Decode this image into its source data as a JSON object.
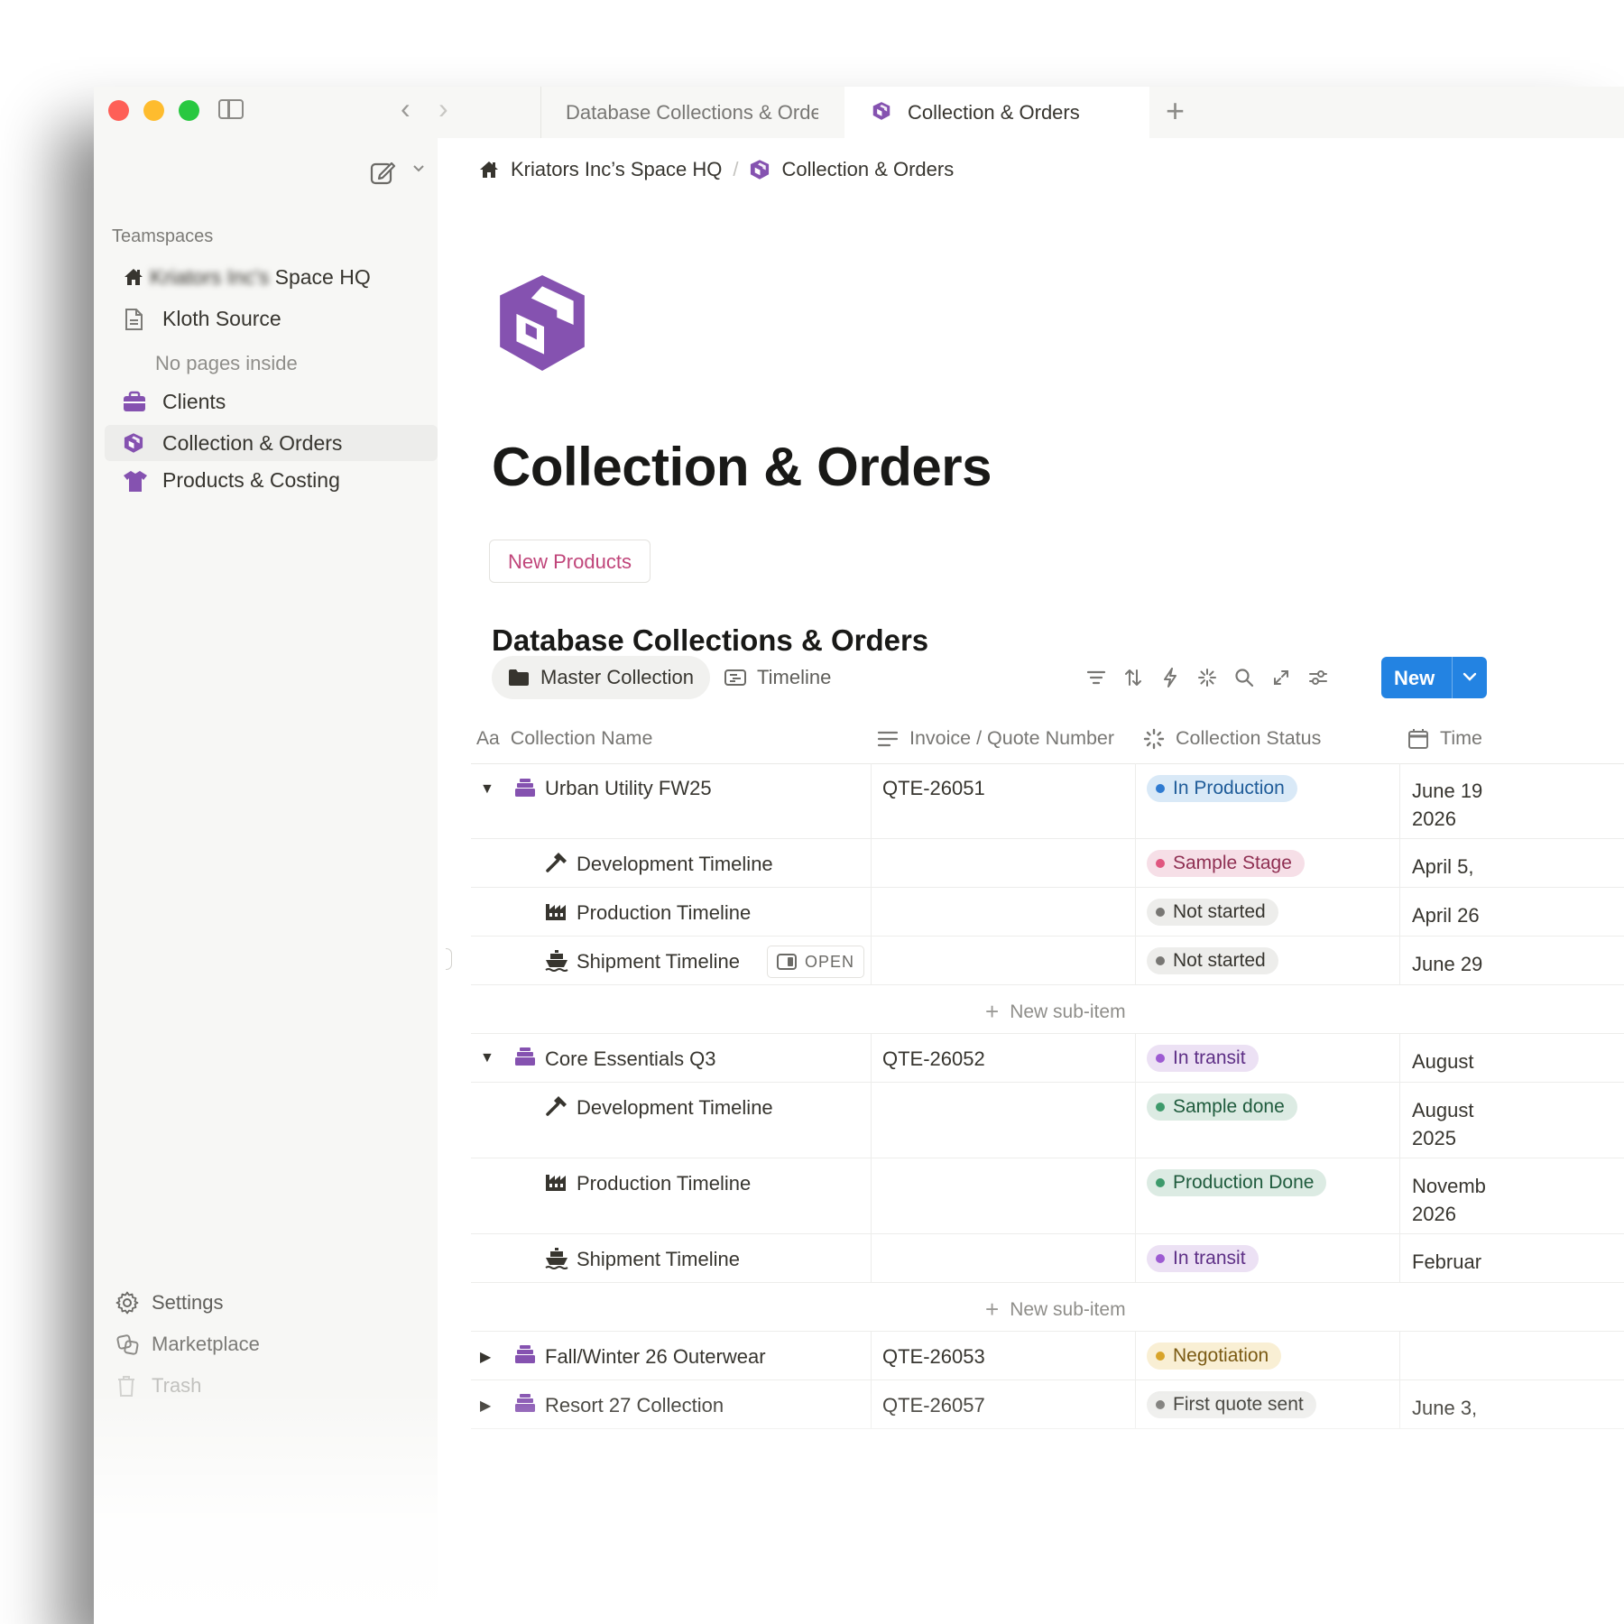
{
  "tabs": [
    {
      "label": "Database Collections & Orders"
    },
    {
      "label": "Collection & Orders"
    }
  ],
  "sidebar": {
    "section": "Teamspaces",
    "workspace": {
      "blurred": "Kriators Inc's",
      "rest": " Space HQ"
    },
    "items": [
      {
        "label": "Kloth Source",
        "icon": "document-icon"
      },
      {
        "label": "No pages inside"
      },
      {
        "label": "Clients",
        "icon": "briefcase-icon"
      },
      {
        "label": "Collection & Orders",
        "icon": "cube-icon"
      },
      {
        "label": "Products & Costing",
        "icon": "tshirt-icon"
      }
    ],
    "bottom": [
      {
        "label": "Settings",
        "icon": "gear-icon"
      },
      {
        "label": "Marketplace",
        "icon": "marketplace-icon"
      },
      {
        "label": "Trash",
        "icon": "trash-icon"
      }
    ]
  },
  "breadcrumb": [
    {
      "label": "Kriators Inc’s Space HQ",
      "icon": "home-icon"
    },
    {
      "label": "Collection & Orders",
      "icon": "cube-icon"
    }
  ],
  "page": {
    "title": "Collection & Orders",
    "linked_chip": "New Products",
    "db_title": "Database Collections & Orders"
  },
  "views": [
    {
      "label": "Master Collection",
      "icon": "folder-icon"
    },
    {
      "label": "Timeline",
      "icon": "timeline-icon"
    }
  ],
  "toolbar": {
    "new_label": "New"
  },
  "columns": [
    {
      "label": "Collection Name",
      "icon_text": "Aa"
    },
    {
      "label": "Invoice / Quote Number"
    },
    {
      "label": "Collection Status"
    },
    {
      "label": "Time"
    }
  ],
  "rows": {
    "r1": {
      "name": "Urban Utility FW25",
      "invoice": "QTE-26051",
      "status": "In Production",
      "time": [
        "June 19",
        "2026"
      ]
    },
    "r1a": {
      "name": "Development Timeline",
      "status": "Sample Stage",
      "time": [
        "April 5,"
      ]
    },
    "r1b": {
      "name": "Production Timeline",
      "status": "Not started",
      "time": [
        "April 26"
      ]
    },
    "r1c": {
      "name": "Shipment Timeline",
      "status": "Not started",
      "time": [
        "June 29"
      ],
      "open_label": "OPEN"
    },
    "r2": {
      "name": "Core Essentials Q3",
      "invoice": "QTE-26052",
      "status": "In transit",
      "time": [
        "August"
      ]
    },
    "r2a": {
      "name": "Development Timeline",
      "status": "Sample done",
      "time": [
        "August",
        "2025"
      ]
    },
    "r2b": {
      "name": "Production Timeline",
      "status": "Production Done",
      "time": [
        "Novemb",
        "2026"
      ]
    },
    "r2c": {
      "name": "Shipment Timeline",
      "status": "In transit",
      "time": [
        "Februar"
      ]
    },
    "r3": {
      "name": "Fall/Winter 26 Outerwear",
      "invoice": "QTE-26053",
      "status": "Negotiation",
      "time": []
    },
    "r4": {
      "name": "Resort 27 Collection",
      "invoice": "QTE-26057",
      "status": "First quote sent",
      "time": [
        "June 3,"
      ]
    }
  },
  "new_sub_item": "New sub-item",
  "colors": {
    "accent_blue": "#2383e2",
    "purple_icon": "#8552b0",
    "chip_text": "#c0457a"
  }
}
